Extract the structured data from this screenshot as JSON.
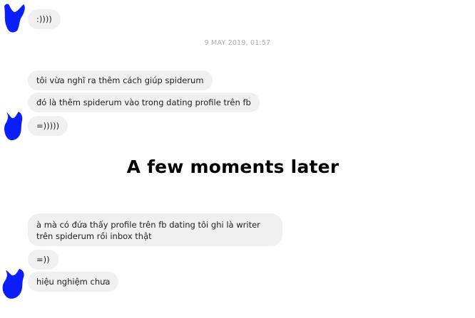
{
  "messages_top": [
    ":))))"
  ],
  "timestamp": "9 MAY 2019, 01:57",
  "group1": [
    "tôi vừa nghĩ ra thêm cách giúp spiderum",
    "đó là thêm spiderum vào trong dating profile trên fb",
    "=)))))"
  ],
  "caption": "A few moments later",
  "group2": [
    "à mà có đứa thấy profile trên fb dating tôi ghi là writer trên spiderum rồi inbox thật",
    "=))",
    "hiệu nghiệm chưa"
  ],
  "colors": {
    "bubble": "#f1f0f0",
    "avatar_scribble": "#0a1eff",
    "timestamp": "#a6abb3"
  },
  "icons": [
    "avatar-scribble-icon"
  ]
}
